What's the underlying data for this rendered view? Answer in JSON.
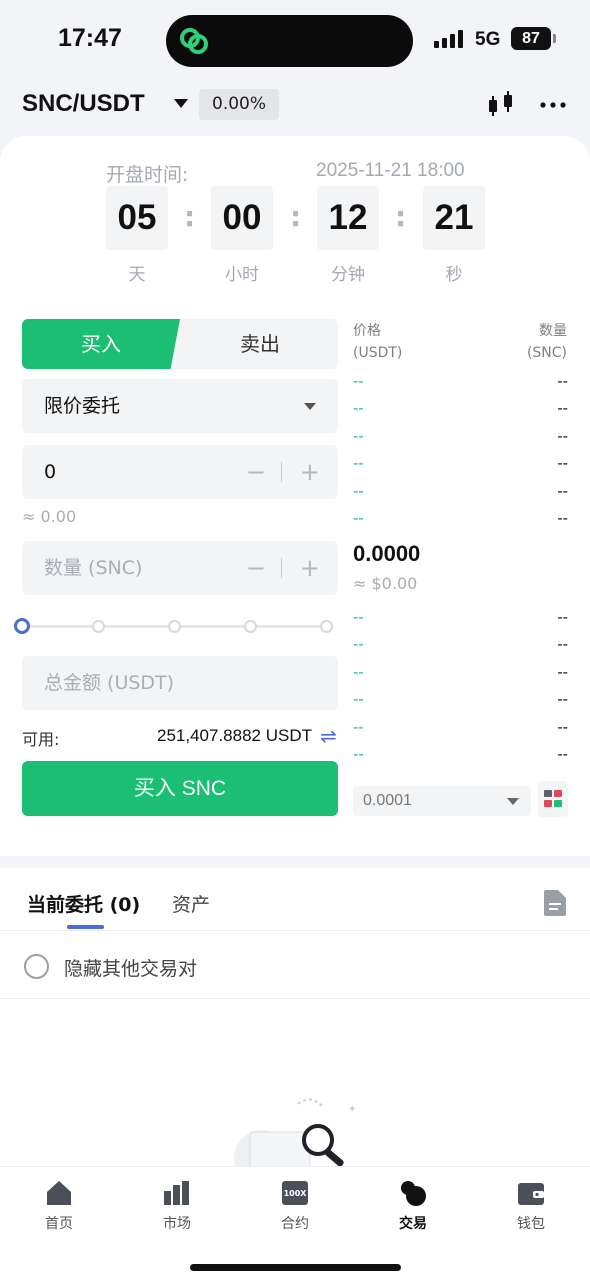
{
  "status_bar": {
    "time": "17:47",
    "network": "5G",
    "battery": "87"
  },
  "header": {
    "pair": "SNC/USDT",
    "change": "0.00%"
  },
  "countdown": {
    "label": "开盘时间:",
    "datetime": "2025-11-21 18:00",
    "days": "05",
    "hours": "00",
    "minutes": "12",
    "seconds": "21",
    "days_unit": "天",
    "hours_unit": "小时",
    "minutes_unit": "分钟",
    "seconds_unit": "秒",
    "separator": ":"
  },
  "order_form": {
    "buy_tab": "买入",
    "sell_tab": "卖出",
    "order_type": "限价委托",
    "price_value": "0",
    "price_approx": "≈ 0.00",
    "amount_placeholder": "数量 (SNC)",
    "total_placeholder": "总金额 (USDT)",
    "minus": "−",
    "plus": "+",
    "slider_percent": 0,
    "available_label": "可用:",
    "available_value": "251,407.8882 USDT",
    "submit": "买入 SNC"
  },
  "order_book": {
    "price_header_1": "价格",
    "price_header_2": "(USDT)",
    "qty_header_1": "数量",
    "qty_header_2": "(SNC)",
    "asks": [
      {
        "price": "--",
        "qty": "--"
      },
      {
        "price": "--",
        "qty": "--"
      },
      {
        "price": "--",
        "qty": "--"
      },
      {
        "price": "--",
        "qty": "--"
      },
      {
        "price": "--",
        "qty": "--"
      },
      {
        "price": "--",
        "qty": "--"
      }
    ],
    "last_price": "0.0000",
    "last_fiat": "≈ $0.00",
    "bids": [
      {
        "price": "--",
        "qty": "--"
      },
      {
        "price": "--",
        "qty": "--"
      },
      {
        "price": "--",
        "qty": "--"
      },
      {
        "price": "--",
        "qty": "--"
      },
      {
        "price": "--",
        "qty": "--"
      },
      {
        "price": "--",
        "qty": "--"
      }
    ],
    "tick_size": "0.0001"
  },
  "orders_panel": {
    "open_orders_tab": "当前委托 (0)",
    "assets_tab": "资产",
    "hide_other_pairs": "隐藏其他交易对"
  },
  "bottom_nav": [
    {
      "label": "首页",
      "icon": "home-icon"
    },
    {
      "label": "市场",
      "icon": "market-icon"
    },
    {
      "label": "合约",
      "icon": "futures-icon",
      "icon_text": "100X"
    },
    {
      "label": "交易",
      "icon": "trade-icon"
    },
    {
      "label": "钱包",
      "icon": "wallet-icon"
    }
  ],
  "colors": {
    "buy": "#1cbe74",
    "accent": "#4b6bd6"
  }
}
